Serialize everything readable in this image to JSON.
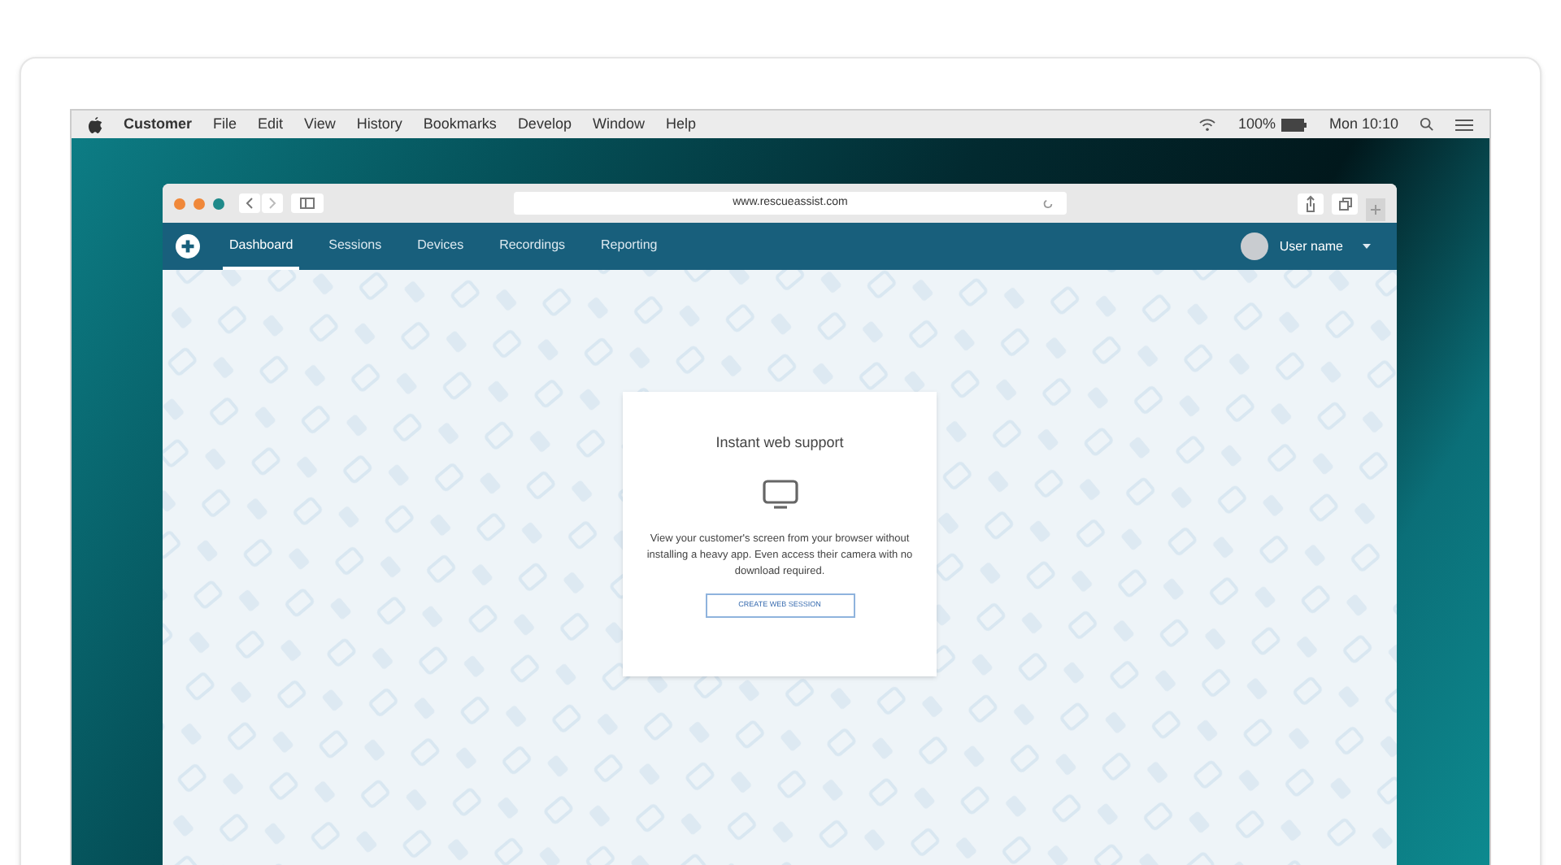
{
  "menu_bar": {
    "app_name": "Customer",
    "menus": [
      "File",
      "Edit",
      "View",
      "History",
      "Bookmarks",
      "Develop",
      "Window",
      "Help"
    ],
    "battery": "100%",
    "clock": "Mon 10:10"
  },
  "browser": {
    "url": "www.rescueassist.com"
  },
  "nav": {
    "tabs": [
      {
        "label": "Dashboard",
        "selected": true
      },
      {
        "label": "Sessions",
        "selected": false
      },
      {
        "label": "Devices",
        "selected": false
      },
      {
        "label": "Recordings",
        "selected": false
      },
      {
        "label": "Reporting",
        "selected": false
      }
    ],
    "user_name": "User name"
  },
  "card": {
    "title": "Instant web support",
    "body": "View your customer's screen from your browser without installing a heavy app. Even access their camera with no download required.",
    "button": "CREATE WEB SESSION"
  }
}
